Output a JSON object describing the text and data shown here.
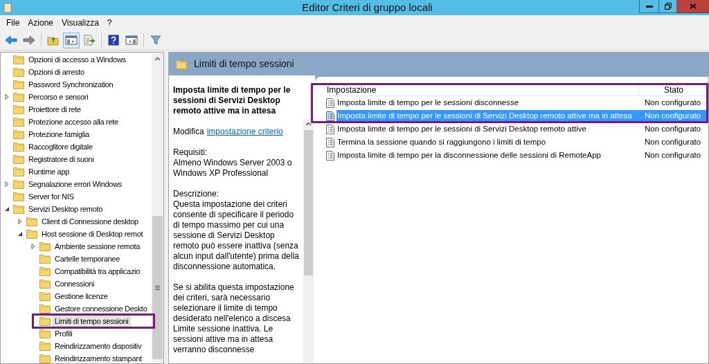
{
  "window": {
    "title": "Editor Criteri di gruppo locali"
  },
  "menu": [
    "File",
    "Azione",
    "Visualizza",
    "?"
  ],
  "toolbar": [
    {
      "kind": "back",
      "pressed": false
    },
    {
      "kind": "forward",
      "pressed": false
    },
    {
      "kind": "separator"
    },
    {
      "kind": "up",
      "pressed": false
    },
    {
      "kind": "tree",
      "pressed": true
    },
    {
      "kind": "export",
      "pressed": false
    },
    {
      "kind": "separator"
    },
    {
      "kind": "help",
      "pressed": false
    },
    {
      "kind": "pane",
      "pressed": false
    },
    {
      "kind": "separator"
    },
    {
      "kind": "filter",
      "pressed": false
    }
  ],
  "tree": [
    {
      "label": "Opzioni di accesso a Windows",
      "selected": false
    },
    {
      "label": "Opzioni di arresto",
      "selected": false
    },
    {
      "label": "Password Synchronization",
      "selected": false
    },
    {
      "label": "Percorso e sensori",
      "selected": false,
      "expanded": false
    },
    {
      "label": "Proiettore di rete",
      "selected": false
    },
    {
      "label": "Protezione accesso alla rete",
      "selected": false
    },
    {
      "label": "Protezione famiglia",
      "selected": false
    },
    {
      "label": "Raccoglitore digitale",
      "selected": false
    },
    {
      "label": "Registratore di suoni",
      "selected": false
    },
    {
      "label": "Runtime app",
      "selected": false
    },
    {
      "label": "Segnalazione errori Windows",
      "selected": false,
      "expanded": false
    },
    {
      "label": "Server for NIS",
      "selected": false
    },
    {
      "label": "Servizi Desktop remoto",
      "selected": false,
      "expanded": true,
      "children": [
        {
          "label": "Client di Connessione desktop",
          "selected": false,
          "expanded": false
        },
        {
          "label": "Host sessione di Desktop remot",
          "selected": false,
          "expanded": true,
          "children": [
            {
              "label": "Ambiente sessione remota",
              "selected": false,
              "expanded": false
            },
            {
              "label": "Cartelle temporanee",
              "selected": false
            },
            {
              "label": "Compatibilità tra applicazio",
              "selected": false
            },
            {
              "label": "Connessioni",
              "selected": false
            },
            {
              "label": "Gestione licenze",
              "selected": false
            },
            {
              "label": "Gestore connessione Deskto",
              "selected": false
            },
            {
              "label": "Limiti di tempo sessioni",
              "selected": true
            },
            {
              "label": "Profili",
              "selected": false
            },
            {
              "label": "Reindirizzamento dispositiv",
              "selected": false
            },
            {
              "label": "Reindirizzamento stampant",
              "selected": false
            }
          ]
        }
      ]
    }
  ],
  "header": {
    "title": "Limiti di tempo sessioni"
  },
  "description": {
    "title": "Imposta limite di tempo per le sessioni di Servizi Desktop remoto attive ma in attesa",
    "edit_prefix": "Modifica",
    "edit_link": "impostazione criterio",
    "requirements_label": "Requisiti:",
    "requirements": "Almeno Windows Server 2003 o Windows XP Professional",
    "description_label": "Descrizione:",
    "paragraphs": [
      "Questa impostazione dei criteri consente di specificare il periodo di tempo massimo per cui una sessione di Servizi Desktop remoto può essere inattiva (senza alcun input dall'utente) prima della disconnessione automatica.",
      "Se si abilita questa impostazione dei criteri, sarà necessario selezionare il limite di tempo desiderato nell'elenco a discesa Limite sessione inattiva. Le sessioni attive ma in attesa verranno disconnesse"
    ]
  },
  "table": {
    "columns": [
      "Impostazione",
      "Stato"
    ],
    "rows": [
      {
        "setting": "Imposta limite di tempo per le sessioni disconnesse",
        "state": "Non configurato",
        "selected": false
      },
      {
        "setting": "Imposta limite di tempo per le sessioni di Servizi Desktop remoto attive ma in attesa",
        "state": "Non configurato",
        "selected": true
      },
      {
        "setting": "Imposta limite di tempo per le sessioni di Servizi Desktop remoto attive",
        "state": "Non configurato",
        "selected": false
      },
      {
        "setting": "Termina la sessione quando si raggiungono i limiti di tempo",
        "state": "Non configurato",
        "selected": false
      },
      {
        "setting": "Imposta limite di tempo per la disconnessione delle sessioni di RemoteApp",
        "state": "Non configurato",
        "selected": false
      }
    ]
  }
}
